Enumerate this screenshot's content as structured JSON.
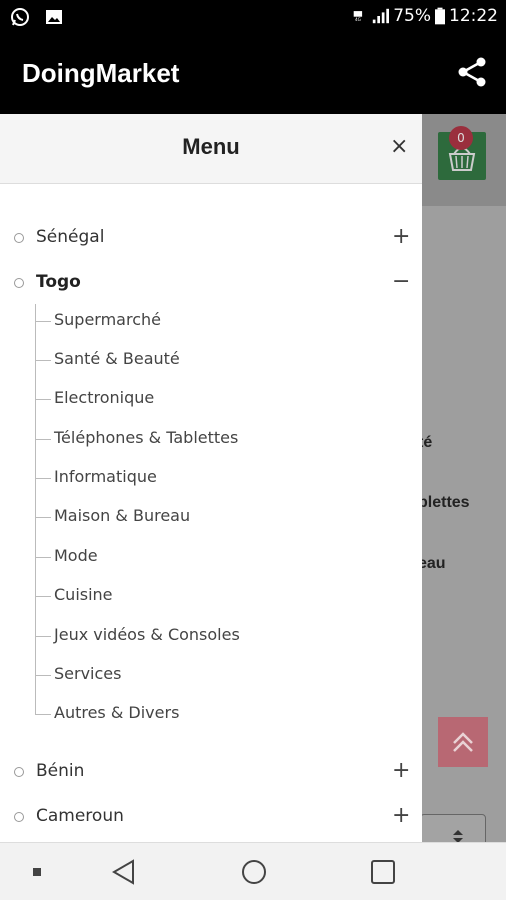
{
  "status_bar": {
    "battery": "75%",
    "time": "12:22",
    "icons": [
      "whatsapp-icon",
      "image-icon",
      "hd-icon",
      "signal-icon",
      "battery-icon"
    ]
  },
  "app_bar": {
    "title": "DoingMarket",
    "share_icon": "share-icon"
  },
  "background_page": {
    "cart_count": "0",
    "partial_texts": [
      "té",
      "blettes",
      "eau"
    ]
  },
  "drawer": {
    "title": "Menu",
    "close_icon": "×",
    "countries": [
      {
        "label": "Sénégal",
        "toggle": "+",
        "expanded": false
      },
      {
        "label": "Togo",
        "toggle": "−",
        "expanded": true
      },
      {
        "label": "Bénin",
        "toggle": "+",
        "expanded": false
      },
      {
        "label": "Cameroun",
        "toggle": "+",
        "expanded": false
      }
    ],
    "togo_categories": [
      "Supermarché",
      "Santé & Beauté",
      "Electronique",
      "Téléphones & Tablettes",
      "Informatique",
      "Maison & Bureau",
      "Mode",
      "Cuisine",
      "Jeux vidéos & Consoles",
      "Services",
      "Autres & Divers"
    ]
  },
  "nav_bar": {
    "buttons": [
      "recent-dot-icon",
      "back-icon",
      "home-icon",
      "overview-icon"
    ]
  }
}
